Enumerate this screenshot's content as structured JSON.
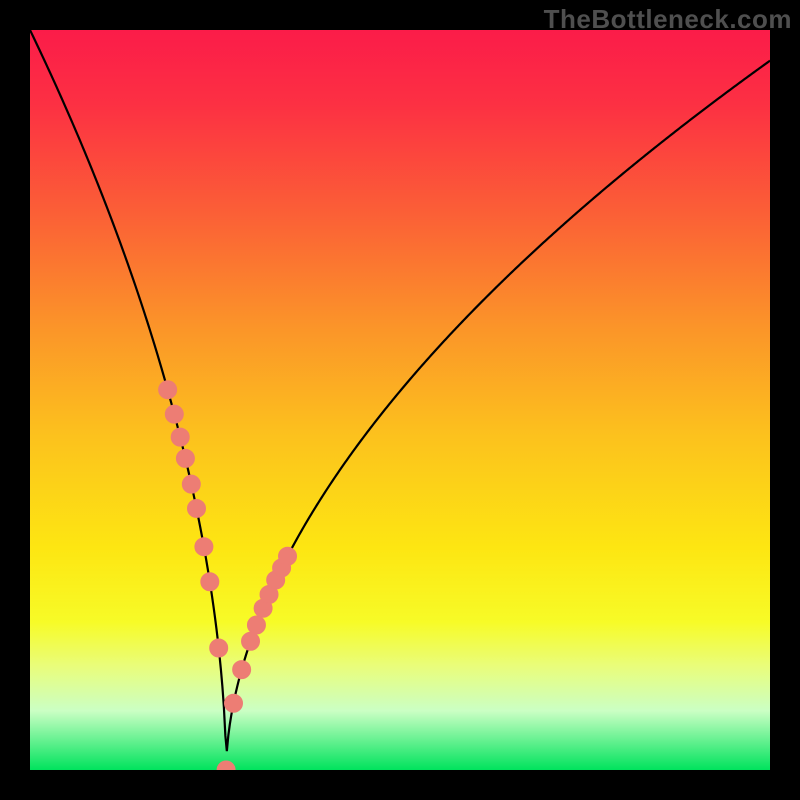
{
  "watermark": "TheBottleneck.com",
  "colors": {
    "frame": "#000000",
    "gradient_stops": [
      {
        "offset": 0.0,
        "color": "#fb1c49"
      },
      {
        "offset": 0.1,
        "color": "#fc3043"
      },
      {
        "offset": 0.25,
        "color": "#fb6036"
      },
      {
        "offset": 0.4,
        "color": "#fb9429"
      },
      {
        "offset": 0.55,
        "color": "#fcc21d"
      },
      {
        "offset": 0.7,
        "color": "#fde612"
      },
      {
        "offset": 0.8,
        "color": "#f7fb27"
      },
      {
        "offset": 0.86,
        "color": "#e9fd7b"
      },
      {
        "offset": 0.92,
        "color": "#cbffc4"
      },
      {
        "offset": 1.0,
        "color": "#00e35d"
      }
    ],
    "curve": "#000000",
    "marker_fill": "#ed7d74",
    "marker_stroke": "#ed7d74"
  },
  "chart_data": {
    "type": "line",
    "title": "",
    "xlabel": "",
    "ylabel": "",
    "xlim": [
      0,
      100
    ],
    "ylim": [
      0,
      100
    ],
    "curve": {
      "x_min": 26.5,
      "y_at_x0": 100,
      "left_shape": 0.55,
      "right_scale": 32,
      "right_power": 0.55
    },
    "markers_x": [
      18.6,
      19.5,
      20.3,
      21.0,
      21.8,
      22.5,
      23.5,
      24.3,
      25.5,
      26.5,
      27.5,
      28.6,
      29.8,
      30.6,
      31.5,
      32.3,
      33.2,
      34.0,
      34.8
    ]
  }
}
